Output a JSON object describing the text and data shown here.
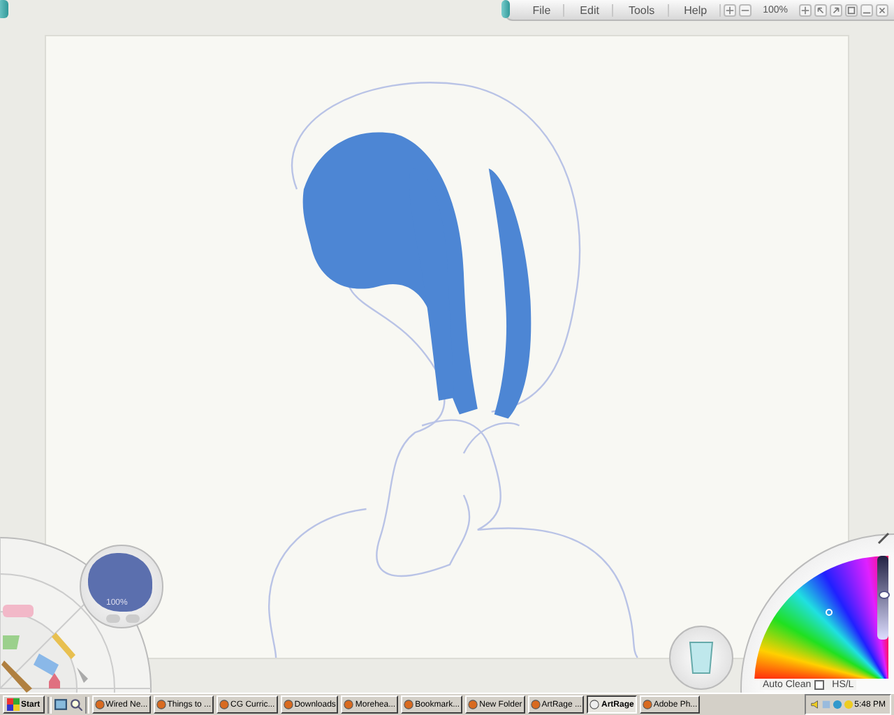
{
  "menu_bar": {
    "items": [
      "File",
      "Edit",
      "Tools",
      "Help"
    ],
    "zoom": "100%"
  },
  "preview": {
    "label": "100%"
  },
  "color_picker": {
    "auto_clean": {
      "label": "Auto Clean",
      "checked": false
    },
    "mode": "HS/L",
    "level": 0.55
  },
  "taskbar": {
    "start": "Start",
    "tasks": [
      {
        "label": "Wired Ne...",
        "selected": false
      },
      {
        "label": "Things to ...",
        "selected": false
      },
      {
        "label": "CG Curric...",
        "selected": false
      },
      {
        "label": "Downloads",
        "selected": false
      },
      {
        "label": "Morehea...",
        "selected": false
      },
      {
        "label": "Bookmark...",
        "selected": false
      },
      {
        "label": "New Folder",
        "selected": false
      },
      {
        "label": "ArtRage ...",
        "selected": false
      },
      {
        "label": "ArtRage",
        "selected": true
      },
      {
        "label": "Adobe Ph...",
        "selected": false
      }
    ],
    "clock": "5:48 PM"
  }
}
